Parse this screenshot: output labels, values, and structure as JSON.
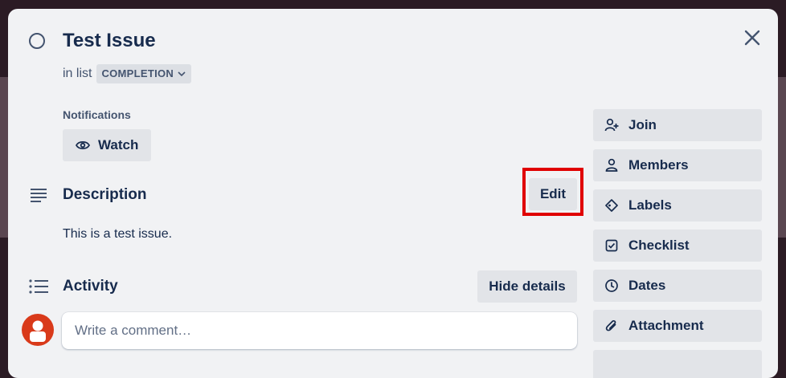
{
  "card": {
    "title": "Test Issue",
    "in_list_prefix": "in list",
    "list_name": "COMPLETION"
  },
  "notifications": {
    "label": "Notifications",
    "watch_label": "Watch"
  },
  "description": {
    "title": "Description",
    "edit_label": "Edit",
    "text": "This is a test issue."
  },
  "activity": {
    "title": "Activity",
    "hide_details_label": "Hide details",
    "comment_placeholder": "Write a comment…"
  },
  "sidebar": {
    "items": [
      {
        "label": "Join",
        "icon": "add-person-icon"
      },
      {
        "label": "Members",
        "icon": "person-icon"
      },
      {
        "label": "Labels",
        "icon": "tag-icon"
      },
      {
        "label": "Checklist",
        "icon": "checkbox-icon"
      },
      {
        "label": "Dates",
        "icon": "clock-icon"
      },
      {
        "label": "Attachment",
        "icon": "paperclip-icon"
      }
    ]
  },
  "colors": {
    "highlight": "#e00000",
    "avatar": "#d93a1a",
    "modal_bg": "#f1f2f4"
  }
}
